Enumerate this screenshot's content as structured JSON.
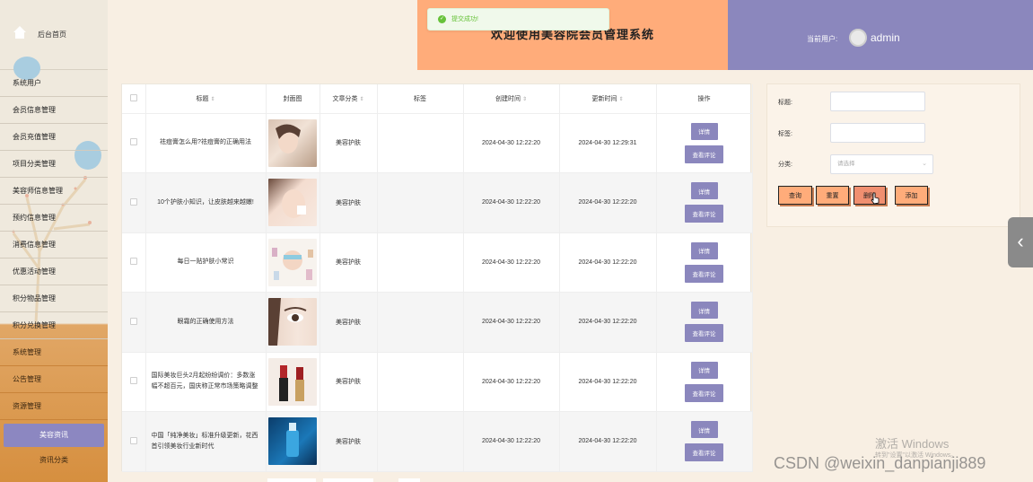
{
  "sidebar": {
    "home_label": "后台首页",
    "items": [
      "系统用户",
      "会员信息管理",
      "会员充值管理",
      "项目分类管理",
      "美容师信息管理",
      "预约信息管理",
      "消费信息管理",
      "优惠活动管理",
      "积分物品管理",
      "积分兑换管理",
      "系统管理",
      "公告管理",
      "资源管理"
    ],
    "active_item": "美容资讯",
    "sub_item": "资讯分类"
  },
  "header": {
    "title": "欢迎使用美容院会员管理系统",
    "user_label": "当前用户:",
    "username": "admin"
  },
  "toast": {
    "text": "提交成功!"
  },
  "table": {
    "columns": {
      "title": "标题",
      "cover": "封面图",
      "category": "文章分类",
      "tags": "标签",
      "created": "创建时间",
      "updated": "更新时间",
      "actions": "操作"
    },
    "detail_label": "详情",
    "comment_label": "查看评论",
    "rows": [
      {
        "title": "祛痘膏怎么用?祛痘膏的正确用法",
        "category": "美容护肤",
        "tags": "",
        "created": "2024-04-30 12:22:20",
        "updated": "2024-04-30 12:29:31"
      },
      {
        "title": "10个护肤小知识，让皮肤越来越嫩!",
        "category": "美容护肤",
        "tags": "",
        "created": "2024-04-30 12:22:20",
        "updated": "2024-04-30 12:22:20"
      },
      {
        "title": "每日一贴护肤小常识",
        "category": "美容护肤",
        "tags": "",
        "created": "2024-04-30 12:22:20",
        "updated": "2024-04-30 12:22:20"
      },
      {
        "title": "眼霜的正确使用方法",
        "category": "美容护肤",
        "tags": "",
        "created": "2024-04-30 12:22:20",
        "updated": "2024-04-30 12:22:20"
      },
      {
        "title": "国际美妆巨头2月起纷纷调价：多数涨幅不超百元，国庆称正常市场策略调整",
        "category": "美容护肤",
        "tags": "",
        "created": "2024-04-30 12:22:20",
        "updated": "2024-04-30 12:22:20"
      },
      {
        "title": "中国「纯净美妆」标准升级更新，花西首引领美妆行业新时代",
        "category": "美容护肤",
        "tags": "",
        "created": "2024-04-30 12:22:20",
        "updated": "2024-04-30 12:22:20"
      }
    ]
  },
  "search": {
    "title_label": "标题:",
    "tags_label": "标签:",
    "category_label": "分类:",
    "category_placeholder": "请选择",
    "query_label": "查询",
    "reset_label": "重置",
    "delete_label": "删除",
    "add_label": "添加"
  },
  "watermark": {
    "activate_title": "激活 Windows",
    "activate_sub": "转到\"设置\"以激活 Windows。",
    "csdn": "CSDN @weixin_danpianji889"
  },
  "colors": {
    "accent_orange": "#ffac7a",
    "accent_purple": "#8b87bd",
    "sidebar_bottom": "#d68f3f"
  }
}
